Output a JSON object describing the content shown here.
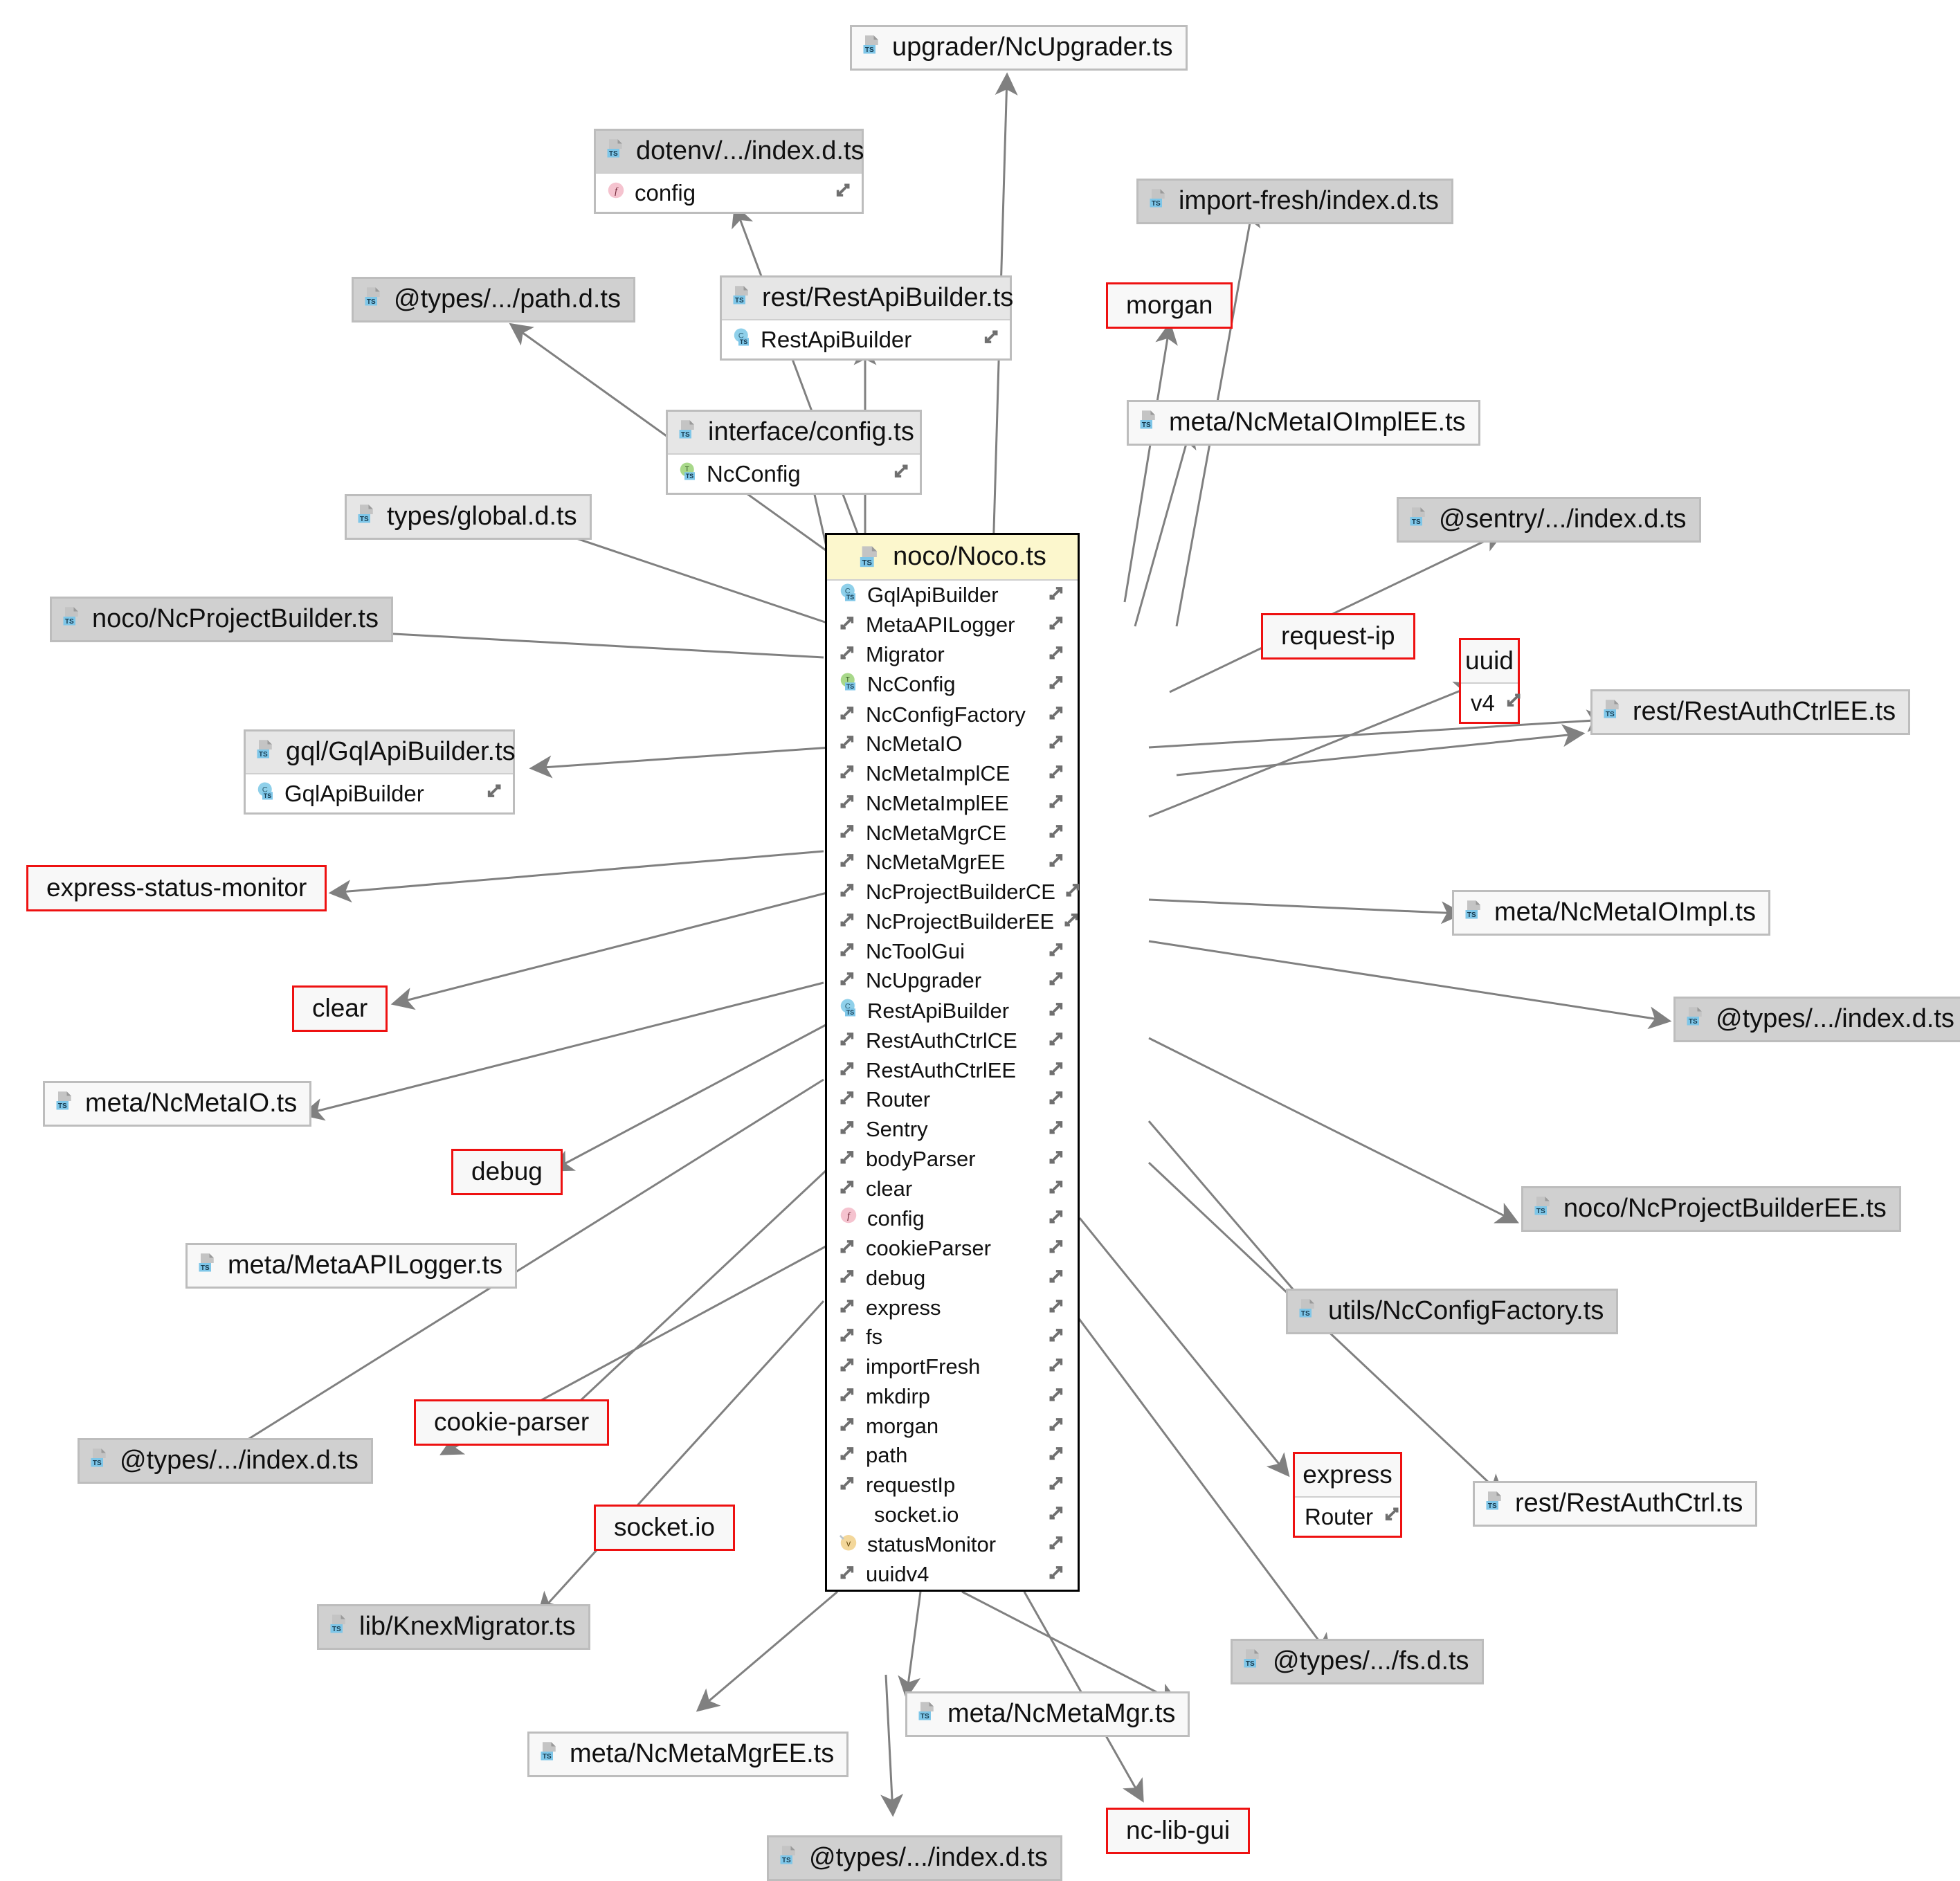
{
  "diagram": {
    "title": "noco/Noco.ts dependency graph",
    "colors": {
      "package_border": "#ee1111",
      "main_header": "#fcf7cd",
      "ts_badge": "#7ec6e8",
      "node_dark": "#d0d0d0",
      "node_light": "#f8f8f8"
    }
  },
  "main_node": {
    "title": "noco/Noco.ts",
    "icon": "ts-file-icon",
    "members": [
      {
        "label": "GqlApiBuilder",
        "icon": "ts-class-icon",
        "right_icon": "import-arrow-icon"
      },
      {
        "label": "MetaAPILogger",
        "icon": "import-arrow-icon",
        "right_icon": "import-arrow-icon"
      },
      {
        "label": "Migrator",
        "icon": "import-arrow-icon",
        "right_icon": "import-arrow-icon"
      },
      {
        "label": "NcConfig",
        "icon": "ts-interface-icon",
        "right_icon": "import-arrow-icon"
      },
      {
        "label": "NcConfigFactory",
        "icon": "import-arrow-icon",
        "right_icon": "import-arrow-icon"
      },
      {
        "label": "NcMetaIO",
        "icon": "import-arrow-icon",
        "right_icon": "import-arrow-icon"
      },
      {
        "label": "NcMetaImplCE",
        "icon": "import-arrow-icon",
        "right_icon": "import-arrow-icon"
      },
      {
        "label": "NcMetaImplEE",
        "icon": "import-arrow-icon",
        "right_icon": "import-arrow-icon"
      },
      {
        "label": "NcMetaMgrCE",
        "icon": "import-arrow-icon",
        "right_icon": "import-arrow-icon"
      },
      {
        "label": "NcMetaMgrEE",
        "icon": "import-arrow-icon",
        "right_icon": "import-arrow-icon"
      },
      {
        "label": "NcProjectBuilderCE",
        "icon": "import-arrow-icon",
        "right_icon": "import-arrow-icon"
      },
      {
        "label": "NcProjectBuilderEE",
        "icon": "import-arrow-icon",
        "right_icon": "import-arrow-icon"
      },
      {
        "label": "NcToolGui",
        "icon": "import-arrow-icon",
        "right_icon": "import-arrow-icon"
      },
      {
        "label": "NcUpgrader",
        "icon": "import-arrow-icon",
        "right_icon": "import-arrow-icon"
      },
      {
        "label": "RestApiBuilder",
        "icon": "ts-class-icon",
        "right_icon": "import-arrow-icon"
      },
      {
        "label": "RestAuthCtrlCE",
        "icon": "import-arrow-icon",
        "right_icon": "import-arrow-icon"
      },
      {
        "label": "RestAuthCtrlEE",
        "icon": "import-arrow-icon",
        "right_icon": "import-arrow-icon"
      },
      {
        "label": "Router",
        "icon": "import-arrow-icon",
        "right_icon": "import-arrow-icon"
      },
      {
        "label": "Sentry",
        "icon": "import-arrow-icon",
        "right_icon": "import-arrow-icon"
      },
      {
        "label": "bodyParser",
        "icon": "import-arrow-icon",
        "right_icon": "import-arrow-icon"
      },
      {
        "label": "clear",
        "icon": "import-arrow-icon",
        "right_icon": "import-arrow-icon"
      },
      {
        "label": "config",
        "icon": "function-icon",
        "right_icon": "import-arrow-icon"
      },
      {
        "label": "cookieParser",
        "icon": "import-arrow-icon",
        "right_icon": "import-arrow-icon"
      },
      {
        "label": "debug",
        "icon": "import-arrow-icon",
        "right_icon": "import-arrow-icon"
      },
      {
        "label": "express",
        "icon": "import-arrow-icon",
        "right_icon": "import-arrow-icon"
      },
      {
        "label": "fs",
        "icon": "import-arrow-icon",
        "right_icon": "import-arrow-icon"
      },
      {
        "label": "importFresh",
        "icon": "import-arrow-icon",
        "right_icon": "import-arrow-icon"
      },
      {
        "label": "mkdirp",
        "icon": "import-arrow-icon",
        "right_icon": "import-arrow-icon"
      },
      {
        "label": "morgan",
        "icon": "import-arrow-icon",
        "right_icon": "import-arrow-icon"
      },
      {
        "label": "path",
        "icon": "import-arrow-icon",
        "right_icon": "import-arrow-icon"
      },
      {
        "label": "requestIp",
        "icon": "import-arrow-icon",
        "right_icon": "import-arrow-icon"
      },
      {
        "label": "socket.io",
        "icon": "none",
        "right_icon": "import-arrow-icon"
      },
      {
        "label": "statusMonitor",
        "icon": "variable-icon",
        "right_icon": "import-arrow-icon"
      },
      {
        "label": "uuidv4",
        "icon": "import-arrow-icon",
        "right_icon": "import-arrow-icon"
      }
    ]
  },
  "nodes": [
    {
      "id": "upgrader-ncupgrader",
      "title": "upgrader/NcUpgrader.ts",
      "icon": "ts-file-icon",
      "kind": "file",
      "shade": "light",
      "members": []
    },
    {
      "id": "dotenv-index",
      "title": "dotenv/.../index.d.ts",
      "icon": "ts-file-icon",
      "kind": "file",
      "shade": "dark",
      "members": [
        {
          "label": "config",
          "icon": "function-icon",
          "right_icon": "export-arrow-icon"
        }
      ]
    },
    {
      "id": "import-fresh-index",
      "title": "import-fresh/index.d.ts",
      "icon": "ts-file-icon",
      "kind": "file",
      "shade": "dark",
      "members": []
    },
    {
      "id": "types-path",
      "title": "@types/.../path.d.ts",
      "icon": "ts-file-icon",
      "kind": "file",
      "shade": "dark",
      "members": []
    },
    {
      "id": "rest-restapibuilder",
      "title": "rest/RestApiBuilder.ts",
      "icon": "ts-file-icon",
      "kind": "file",
      "shade": "mid",
      "members": [
        {
          "label": "RestApiBuilder",
          "icon": "ts-class-icon",
          "right_icon": "export-arrow-icon"
        }
      ]
    },
    {
      "id": "morgan",
      "title": "morgan",
      "icon": "none",
      "kind": "package",
      "shade": "light",
      "members": []
    },
    {
      "id": "meta-ncmetaioimplee",
      "title": "meta/NcMetaIOImplEE.ts",
      "icon": "ts-file-icon",
      "kind": "file",
      "shade": "light",
      "members": []
    },
    {
      "id": "interface-config",
      "title": "interface/config.ts",
      "icon": "ts-file-icon",
      "kind": "file",
      "shade": "mid",
      "members": [
        {
          "label": "NcConfig",
          "icon": "ts-interface-icon",
          "right_icon": "export-arrow-icon"
        }
      ]
    },
    {
      "id": "sentry-index",
      "title": "@sentry/.../index.d.ts",
      "icon": "ts-file-icon",
      "kind": "file",
      "shade": "dark",
      "members": []
    },
    {
      "id": "types-global",
      "title": "types/global.d.ts",
      "icon": "ts-file-icon",
      "kind": "file",
      "shade": "mid",
      "members": []
    },
    {
      "id": "noco-ncprojectbuilder",
      "title": "noco/NcProjectBuilder.ts",
      "icon": "ts-file-icon",
      "kind": "file",
      "shade": "dark",
      "members": []
    },
    {
      "id": "request-ip",
      "title": "request-ip",
      "icon": "none",
      "kind": "package",
      "shade": "light",
      "members": []
    },
    {
      "id": "uuid",
      "title": "uuid",
      "icon": "none",
      "kind": "package",
      "shade": "light",
      "members": [
        {
          "label": "v4",
          "icon": "none",
          "right_icon": "export-arrow-icon"
        }
      ]
    },
    {
      "id": "rest-restauthctrlee",
      "title": "rest/RestAuthCtrlEE.ts",
      "icon": "ts-file-icon",
      "kind": "file",
      "shade": "mid",
      "members": []
    },
    {
      "id": "gql-gqlapibuilder",
      "title": "gql/GqlApiBuilder.ts",
      "icon": "ts-file-icon",
      "kind": "file",
      "shade": "mid",
      "members": [
        {
          "label": "GqlApiBuilder",
          "icon": "ts-class-icon",
          "right_icon": "export-arrow-icon"
        }
      ]
    },
    {
      "id": "express-status-monitor",
      "title": "express-status-monitor",
      "icon": "none",
      "kind": "package",
      "shade": "light",
      "members": []
    },
    {
      "id": "meta-ncmetaioimpl",
      "title": "meta/NcMetaIOImpl.ts",
      "icon": "ts-file-icon",
      "kind": "file",
      "shade": "light",
      "members": []
    },
    {
      "id": "clear",
      "title": "clear",
      "icon": "none",
      "kind": "package",
      "shade": "light",
      "members": []
    },
    {
      "id": "types-index-right",
      "title": "@types/.../index.d.ts",
      "icon": "ts-file-icon",
      "kind": "file",
      "shade": "dark",
      "members": []
    },
    {
      "id": "meta-ncmetaio",
      "title": "meta/NcMetaIO.ts",
      "icon": "ts-file-icon",
      "kind": "file",
      "shade": "light",
      "members": []
    },
    {
      "id": "debug",
      "title": "debug",
      "icon": "none",
      "kind": "package",
      "shade": "light",
      "members": []
    },
    {
      "id": "noco-ncprojectbuilderee",
      "title": "noco/NcProjectBuilderEE.ts",
      "icon": "ts-file-icon",
      "kind": "file",
      "shade": "dark",
      "members": []
    },
    {
      "id": "meta-metaapilogger",
      "title": "meta/MetaAPILogger.ts",
      "icon": "ts-file-icon",
      "kind": "file",
      "shade": "light",
      "members": []
    },
    {
      "id": "utils-ncconfigfactory",
      "title": "utils/NcConfigFactory.ts",
      "icon": "ts-file-icon",
      "kind": "file",
      "shade": "dark",
      "members": []
    },
    {
      "id": "types-index-left",
      "title": "@types/.../index.d.ts",
      "icon": "ts-file-icon",
      "kind": "file",
      "shade": "dark",
      "members": []
    },
    {
      "id": "cookie-parser",
      "title": "cookie-parser",
      "icon": "none",
      "kind": "package",
      "shade": "light",
      "members": []
    },
    {
      "id": "express",
      "title": "express",
      "icon": "none",
      "kind": "package",
      "shade": "light",
      "members": [
        {
          "label": "Router",
          "icon": "none",
          "right_icon": "export-arrow-icon"
        }
      ]
    },
    {
      "id": "rest-restauthctrl",
      "title": "rest/RestAuthCtrl.ts",
      "icon": "ts-file-icon",
      "kind": "file",
      "shade": "light",
      "members": []
    },
    {
      "id": "socket-io",
      "title": "socket.io",
      "icon": "none",
      "kind": "package",
      "shade": "light",
      "members": []
    },
    {
      "id": "lib-knexmigrator",
      "title": "lib/KnexMigrator.ts",
      "icon": "ts-file-icon",
      "kind": "file",
      "shade": "dark",
      "members": []
    },
    {
      "id": "types-fs",
      "title": "@types/.../fs.d.ts",
      "icon": "ts-file-icon",
      "kind": "file",
      "shade": "dark",
      "members": []
    },
    {
      "id": "meta-ncmetamgr",
      "title": "meta/NcMetaMgr.ts",
      "icon": "ts-file-icon",
      "kind": "file",
      "shade": "light",
      "members": []
    },
    {
      "id": "meta-ncmetamgree",
      "title": "meta/NcMetaMgrEE.ts",
      "icon": "ts-file-icon",
      "kind": "file",
      "shade": "light",
      "members": []
    },
    {
      "id": "nc-lib-gui",
      "title": "nc-lib-gui",
      "icon": "none",
      "kind": "package",
      "shade": "light",
      "members": []
    },
    {
      "id": "types-index-bottom",
      "title": "@types/.../index.d.ts",
      "icon": "ts-file-icon",
      "kind": "file",
      "shade": "dark",
      "members": []
    }
  ]
}
